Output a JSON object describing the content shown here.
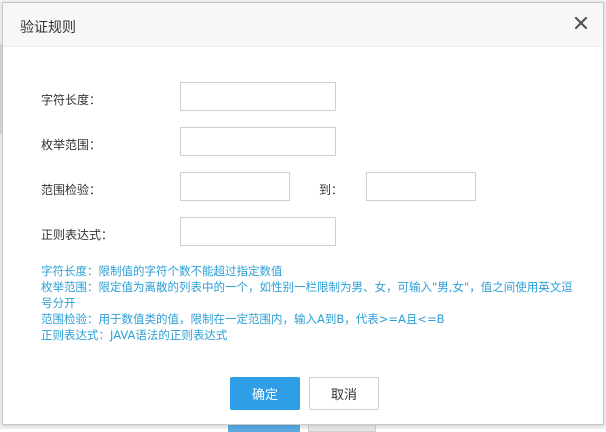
{
  "dialog": {
    "title": "验证规则",
    "close_icon": "close-icon"
  },
  "form": {
    "length_label": "字符长度：",
    "enum_label": "枚举范围：",
    "range_label": "范围检验：",
    "range_to_label": "到：",
    "regex_label": "正则表达式：",
    "length_value": "",
    "enum_value": "",
    "range_from_value": "",
    "range_to_value": "",
    "regex_value": ""
  },
  "help": {
    "line1": "字符长度：限制值的字符个数不能超过指定数值",
    "line2": "枚举范围：限定值为离散的列表中的一个，如性别一栏限制为男、女，可输入\"男,女\"，值之间使用英文逗号分开",
    "line3": "范围检验：用于数值类的值，限制在一定范围内，输入A到B，代表>=A且<=B",
    "line4": "正则表达式：JAVA语法的正则表达式"
  },
  "buttons": {
    "ok": "确定",
    "cancel": "取消"
  },
  "colors": {
    "primary": "#2e9fe6",
    "help_text": "#2b9fd6"
  }
}
